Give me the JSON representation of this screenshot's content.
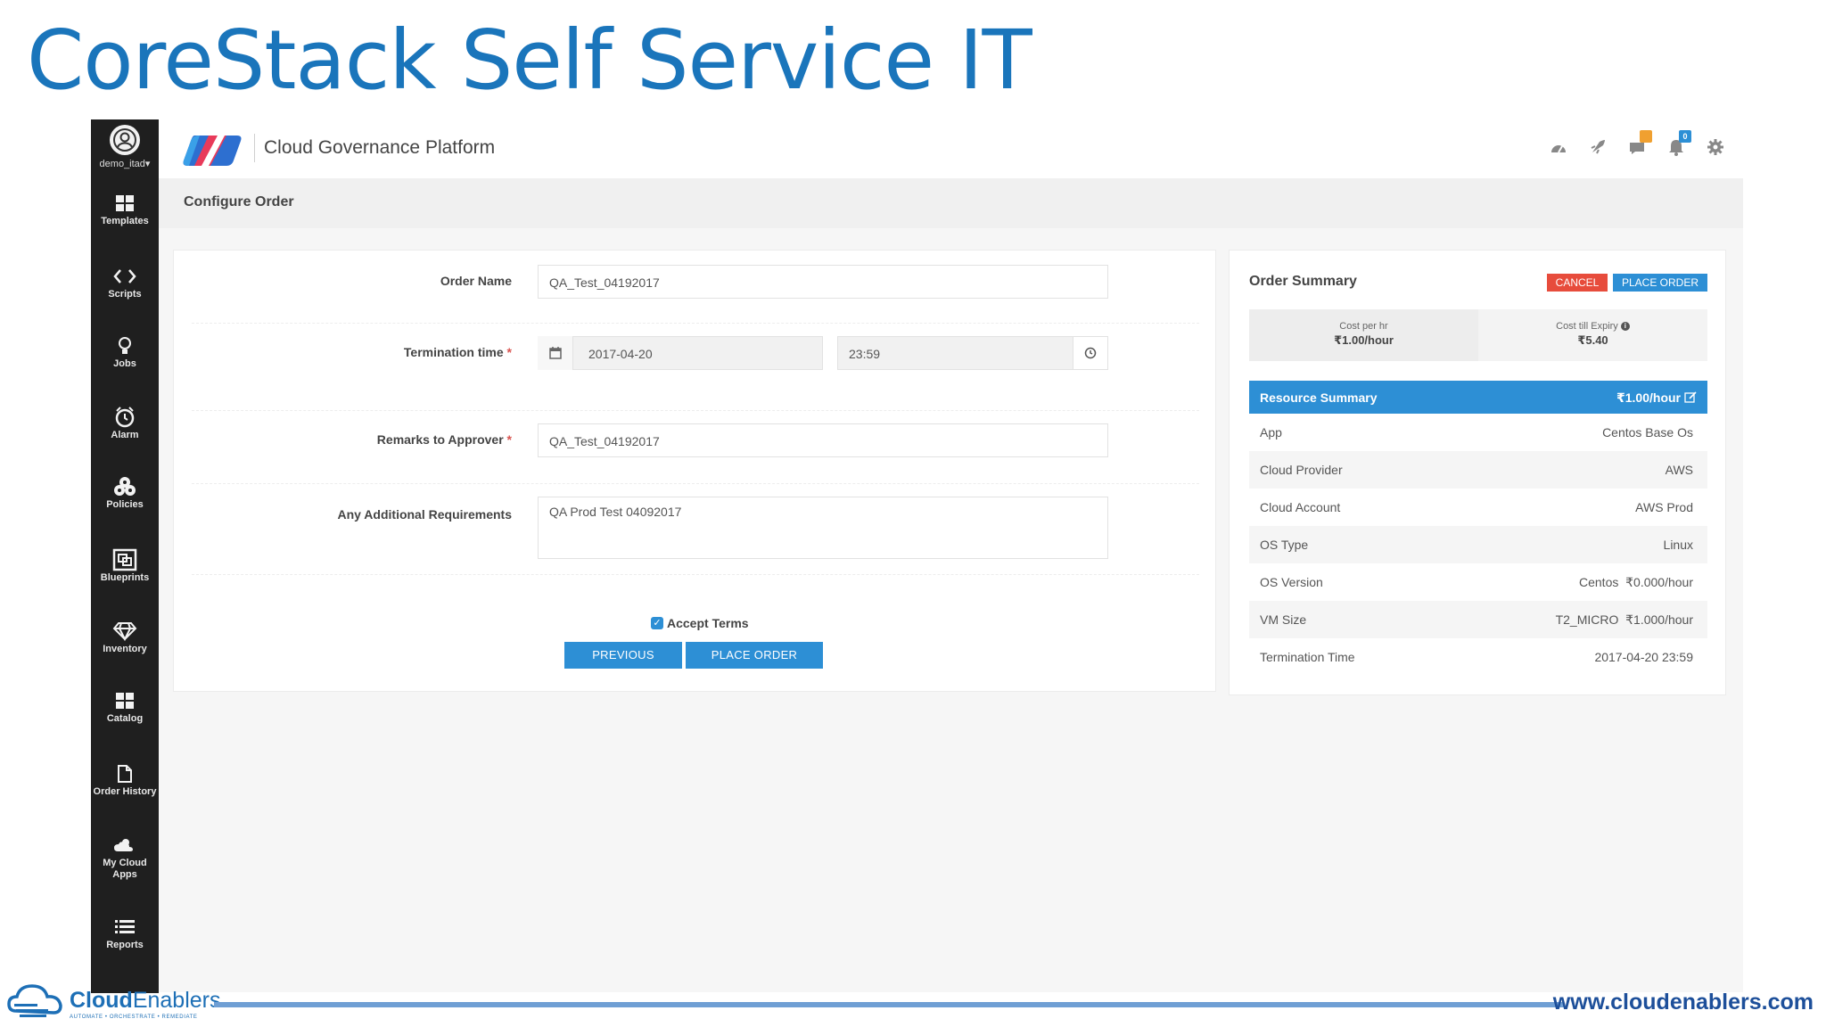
{
  "slide": {
    "title": "CoreStack Self Service IT"
  },
  "user": {
    "name": "demo_itad"
  },
  "sidebar": {
    "items": [
      {
        "label": "Templates",
        "icon": "templates-icon"
      },
      {
        "label": "Scripts",
        "icon": "code-icon"
      },
      {
        "label": "Jobs",
        "icon": "bulb-icon"
      },
      {
        "label": "Alarm",
        "icon": "alarm-icon"
      },
      {
        "label": "Policies",
        "icon": "policies-icon"
      },
      {
        "label": "Blueprints",
        "icon": "blueprint-icon"
      },
      {
        "label": "Inventory",
        "icon": "diamond-icon"
      },
      {
        "label": "Catalog",
        "icon": "catalog-icon"
      },
      {
        "label": "Order History",
        "icon": "document-icon"
      },
      {
        "label": "My Cloud",
        "label2": "Apps",
        "icon": "cloud-icon"
      },
      {
        "label": "Reports",
        "icon": "list-icon"
      }
    ]
  },
  "header": {
    "app_name": "Cloud Governance Platform",
    "icons": [
      "dashboard-icon",
      "rocket-icon",
      "chat-icon",
      "notification-icon",
      "gear-icon"
    ],
    "badges": {
      "messages": "",
      "notifications": "0"
    },
    "colors": {
      "badge_orange": "#f0a030",
      "badge_blue": "#2d8fd5"
    }
  },
  "page": {
    "title": "Configure Order"
  },
  "form": {
    "order_name_label": "Order Name",
    "order_name_value": "QA_Test_04192017",
    "termination_label": "Termination time",
    "required_mark": "*",
    "termination_date": "2017-04-20",
    "termination_time": "23:59",
    "remarks_label": "Remarks to Approver",
    "remarks_value": "QA_Test_04192017",
    "additional_label": "Any Additional Requirements",
    "additional_value": "QA Prod Test 04092017",
    "accept_terms_label": "Accept Terms",
    "accept_terms_checked": true,
    "previous_button": "PREVIOUS",
    "place_order_button": "PLACE ORDER"
  },
  "summary": {
    "title": "Order Summary",
    "cancel_button": "CANCEL",
    "place_order_button": "PLACE ORDER",
    "cost_per_hr_label": "Cost per hr",
    "cost_per_hr_value": "₹1.00/hour",
    "cost_expiry_label": "Cost till Expiry",
    "cost_expiry_value": "₹5.40",
    "resource_title": "Resource Summary",
    "resource_price": "₹1.00/hour",
    "rows": [
      {
        "key": "App",
        "value": "Centos Base Os"
      },
      {
        "key": "Cloud Provider",
        "value": "AWS"
      },
      {
        "key": "Cloud Account",
        "value": "AWS Prod"
      },
      {
        "key": "OS Type",
        "value": "Linux"
      },
      {
        "key": "OS Version",
        "value": "Centos  ₹0.000/hour"
      },
      {
        "key": "VM Size",
        "value": "T2_MICRO  ₹1.000/hour"
      },
      {
        "key": "Termination Time",
        "value": "2017-04-20 23:59"
      }
    ],
    "colors": {
      "cancel": "#e74c3c",
      "primary": "#2d8fd5"
    }
  },
  "footer": {
    "brand_prefix": "Cloud",
    "brand_suffix": "Enablers",
    "tagline": "AUTOMATE  •  ORCHESTRATE  •  REMEDIATE",
    "url": "www.cloudenablers.com"
  }
}
